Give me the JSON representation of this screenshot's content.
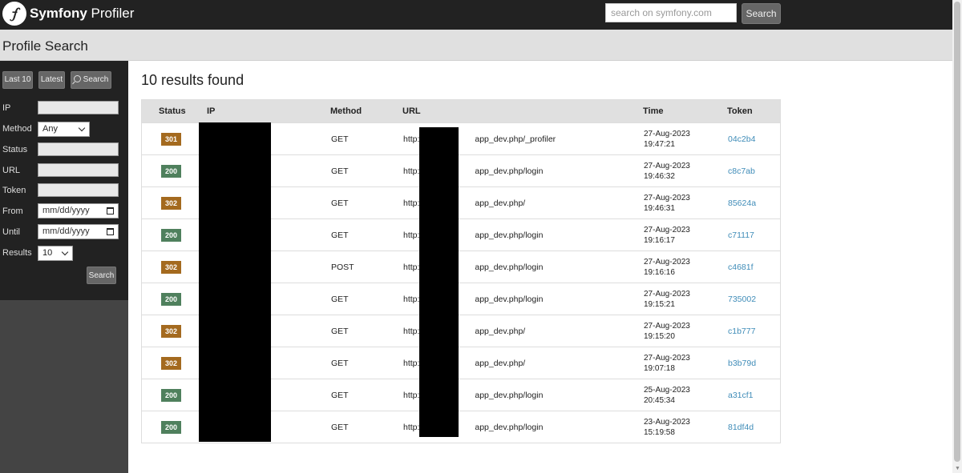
{
  "header": {
    "brand_strong": "Symfony",
    "brand_light": "Profiler",
    "search_placeholder": "search on symfony.com",
    "search_button": "Search"
  },
  "summary": {
    "title": "Profile Search"
  },
  "sidebar": {
    "tabs": {
      "last10": "Last 10",
      "latest": "Latest",
      "search": "Search"
    },
    "labels": {
      "ip": "IP",
      "method": "Method",
      "status": "Status",
      "url": "URL",
      "token": "Token",
      "from": "From",
      "until": "Until",
      "results": "Results"
    },
    "method_value": "Any",
    "from_placeholder": "mm/dd/yyyy",
    "until_placeholder": "mm/dd/yyyy",
    "results_value": "10",
    "search_button": "Search"
  },
  "main": {
    "results_title": "10 results found"
  },
  "table": {
    "headers": {
      "status": "Status",
      "ip": "IP",
      "method": "Method",
      "url": "URL",
      "time": "Time",
      "token": "Token"
    },
    "rows": [
      {
        "status": "301",
        "method": "GET",
        "url": "http:/",
        "url_tail": "app_dev.php/_profiler",
        "date": "27-Aug-2023",
        "time": "19:47:21",
        "token": "04c2b4"
      },
      {
        "status": "200",
        "method": "GET",
        "url": "http:/",
        "url_tail": "app_dev.php/login",
        "date": "27-Aug-2023",
        "time": "19:46:32",
        "token": "c8c7ab"
      },
      {
        "status": "302",
        "method": "GET",
        "url": "http:/",
        "url_tail": "app_dev.php/",
        "date": "27-Aug-2023",
        "time": "19:46:31",
        "token": "85624a"
      },
      {
        "status": "200",
        "method": "GET",
        "url": "http:/",
        "url_tail": "app_dev.php/login",
        "date": "27-Aug-2023",
        "time": "19:16:17",
        "token": "c71117"
      },
      {
        "status": "302",
        "method": "POST",
        "url": "http:/",
        "url_tail": "app_dev.php/login",
        "date": "27-Aug-2023",
        "time": "19:16:16",
        "token": "c4681f"
      },
      {
        "status": "200",
        "method": "GET",
        "url": "http:/",
        "url_tail": "app_dev.php/login",
        "date": "27-Aug-2023",
        "time": "19:15:21",
        "token": "735002"
      },
      {
        "status": "302",
        "method": "GET",
        "url": "http:/",
        "url_tail": "app_dev.php/",
        "date": "27-Aug-2023",
        "time": "19:15:20",
        "token": "c1b777"
      },
      {
        "status": "302",
        "method": "GET",
        "url": "http:/",
        "url_tail": "app_dev.php/",
        "date": "27-Aug-2023",
        "time": "19:07:18",
        "token": "b3b79d"
      },
      {
        "status": "200",
        "method": "GET",
        "url": "http:/",
        "url_tail": "app_dev.php/login",
        "date": "25-Aug-2023",
        "time": "20:45:34",
        "token": "a31cf1"
      },
      {
        "status": "200",
        "method": "GET",
        "url": "http:/",
        "url_tail": "app_dev.php/login",
        "date": "23-Aug-2023",
        "time": "15:19:58",
        "token": "81df4d"
      }
    ]
  },
  "colors": {
    "status_200": "#4f805d",
    "status_3xx": "#a46a1f",
    "token_link": "#3f8cb8"
  }
}
